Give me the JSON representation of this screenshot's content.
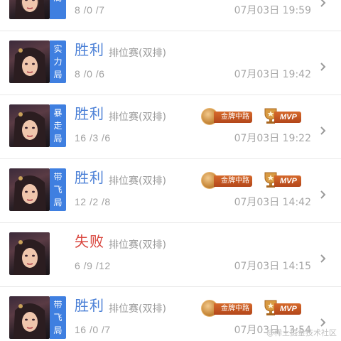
{
  "rows": [
    {
      "tag": [
        "局"
      ],
      "result": "",
      "match_type": "",
      "kda": "8 /0 /7",
      "time": "07月03日 19:59",
      "badges": false
    },
    {
      "tag": [
        "实",
        "力",
        "局"
      ],
      "result": "胜利",
      "match_type": "排位赛(双排)",
      "kda": "8 /0 /6",
      "time": "07月03日 19:42",
      "badges": false
    },
    {
      "tag": [
        "暴",
        "走",
        "局"
      ],
      "result": "胜利",
      "match_type": "排位赛(双排)",
      "kda": "16 /3 /6",
      "time": "07月03日 19:22",
      "badges": true
    },
    {
      "tag": [
        "带",
        "飞",
        "局"
      ],
      "result": "胜利",
      "match_type": "排位赛(双排)",
      "kda": "12 /2 /8",
      "time": "07月03日 14:42",
      "badges": true
    },
    {
      "tag": [],
      "result": "失败",
      "match_type": "排位赛(双排)",
      "kda": "6 /9 /12",
      "time": "07月03日 14:15",
      "badges": false
    },
    {
      "tag": [
        "带",
        "飞",
        "局"
      ],
      "result": "胜利",
      "match_type": "排位赛(双排)",
      "kda": "16 /0 /7",
      "time": "07月03日 13:54",
      "badges": true
    }
  ],
  "badges": {
    "lane_label": "金牌中路",
    "mvp_label": "MVP"
  },
  "watermark": "@稀土掘金技术社区",
  "colors": {
    "win": "#4a7fd6",
    "lose": "#d9463e",
    "tag_bg": "#3f7fe0"
  }
}
